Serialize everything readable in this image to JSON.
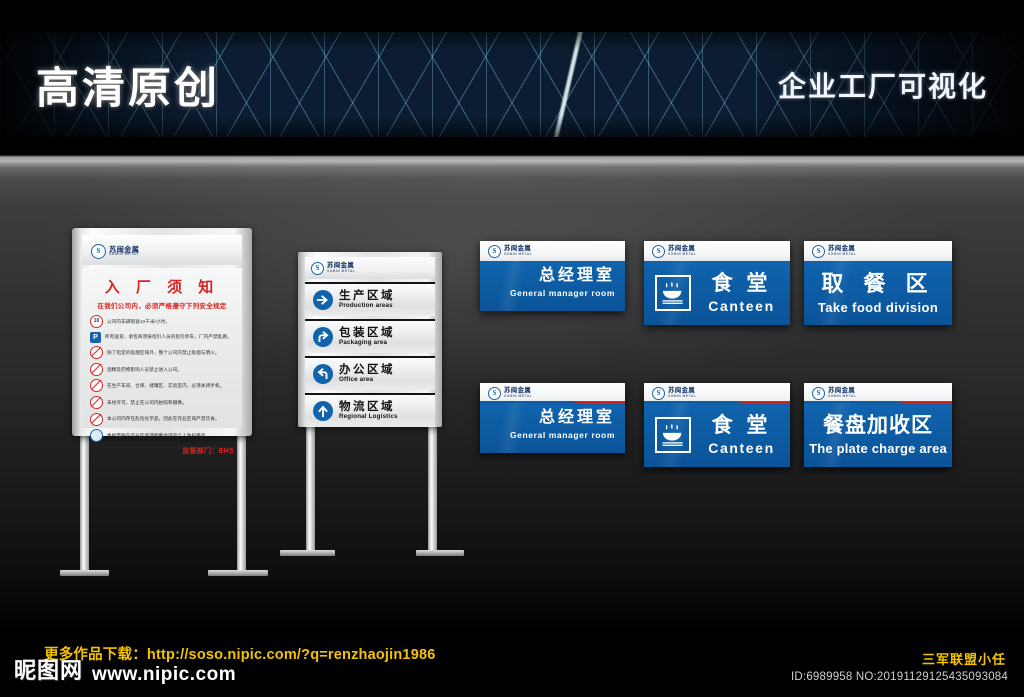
{
  "banner": {
    "title": "高清原创",
    "subtitle": "企业工厂可视化"
  },
  "brand": {
    "mark": "S",
    "cn": "苏闽金属",
    "en": "SUMIN METAL"
  },
  "notice_board": {
    "title": "入 厂 须 知",
    "subtitle": "在我们公司内，必须严格遵守下列安全规定",
    "rules": [
      {
        "icon": "speed-limit-icon",
        "icon_text": "10",
        "text": "公司内车辆限速10千米/小时。"
      },
      {
        "icon": "parking-icon",
        "icon_text": "P",
        "text": "所有送货、承包商须按指引人员的指引停车，厂内严禁乱路。"
      },
      {
        "icon": "no-smoking-icon",
        "icon_text": "",
        "text": "除了指定的吸烟区域外，整个公司内禁止吸烟与明火。"
      },
      {
        "icon": "no-alcohol-icon",
        "icon_text": "",
        "text": "酒精及药物影响人员禁止进入公司。"
      },
      {
        "icon": "no-mobile-icon",
        "icon_text": "",
        "text": "在生产车间、仓库、储罐区、实验室内，必须关闭手机。"
      },
      {
        "icon": "no-camera-icon",
        "icon_text": "",
        "text": "未经许可，禁止在公司内拍照和摄像。"
      },
      {
        "icon": "no-drinking-icon",
        "icon_text": "",
        "text": "本公司内存在危险化学品，因此在作业区域严禁饮食。"
      },
      {
        "icon": "ppe-icon",
        "icon_text": "",
        "text": "根据需要在作业区域须配戴合适的个人防护用品。"
      }
    ],
    "department": "监督部门：EHS"
  },
  "directional_board": {
    "rows": [
      {
        "arrow": "arrow-right-icon",
        "cn": "生产区域",
        "en": "Production areas"
      },
      {
        "arrow": "arrow-turn-right-icon",
        "cn": "包装区域",
        "en": "Packaging area"
      },
      {
        "arrow": "arrow-turn-left-icon",
        "cn": "办公区域",
        "en": "Office area"
      },
      {
        "arrow": "arrow-up-icon",
        "cn": "物流区域",
        "en": "Regional Logistics"
      }
    ]
  },
  "plates": {
    "top_row": [
      {
        "type": "text",
        "cn": "总经理室",
        "en": "General manager room",
        "accent": "none"
      },
      {
        "type": "icon",
        "icon": "canteen-bowl-icon",
        "cn": "食 堂",
        "en": "Canteen",
        "accent": "none"
      },
      {
        "type": "text",
        "cn": "取 餐 区",
        "en": "Take food division",
        "accent": "none"
      }
    ],
    "bottom_row": [
      {
        "type": "text",
        "cn": "总经理室",
        "en": "General manager room",
        "accent": "blue-red"
      },
      {
        "type": "icon",
        "icon": "canteen-bowl-icon",
        "cn": "食 堂",
        "en": "Canteen",
        "accent": "blue-red"
      },
      {
        "type": "text",
        "cn": "餐盘加收区",
        "en": "The plate charge area",
        "accent": "blue-red"
      }
    ]
  },
  "footer": {
    "logo": "昵图网",
    "url": "www.nipic.com",
    "download": "更多作品下载：http://soso.nipic.com/?q=renzhaojin1986",
    "author": "三军联盟小任",
    "id": "ID:6989958 NO:20191129125435093084"
  },
  "colors": {
    "sign_blue": "#0d5ca4",
    "accent_red": "#d8241f",
    "brand_blue": "#1763b0",
    "watermark_yellow": "#f3c300"
  }
}
